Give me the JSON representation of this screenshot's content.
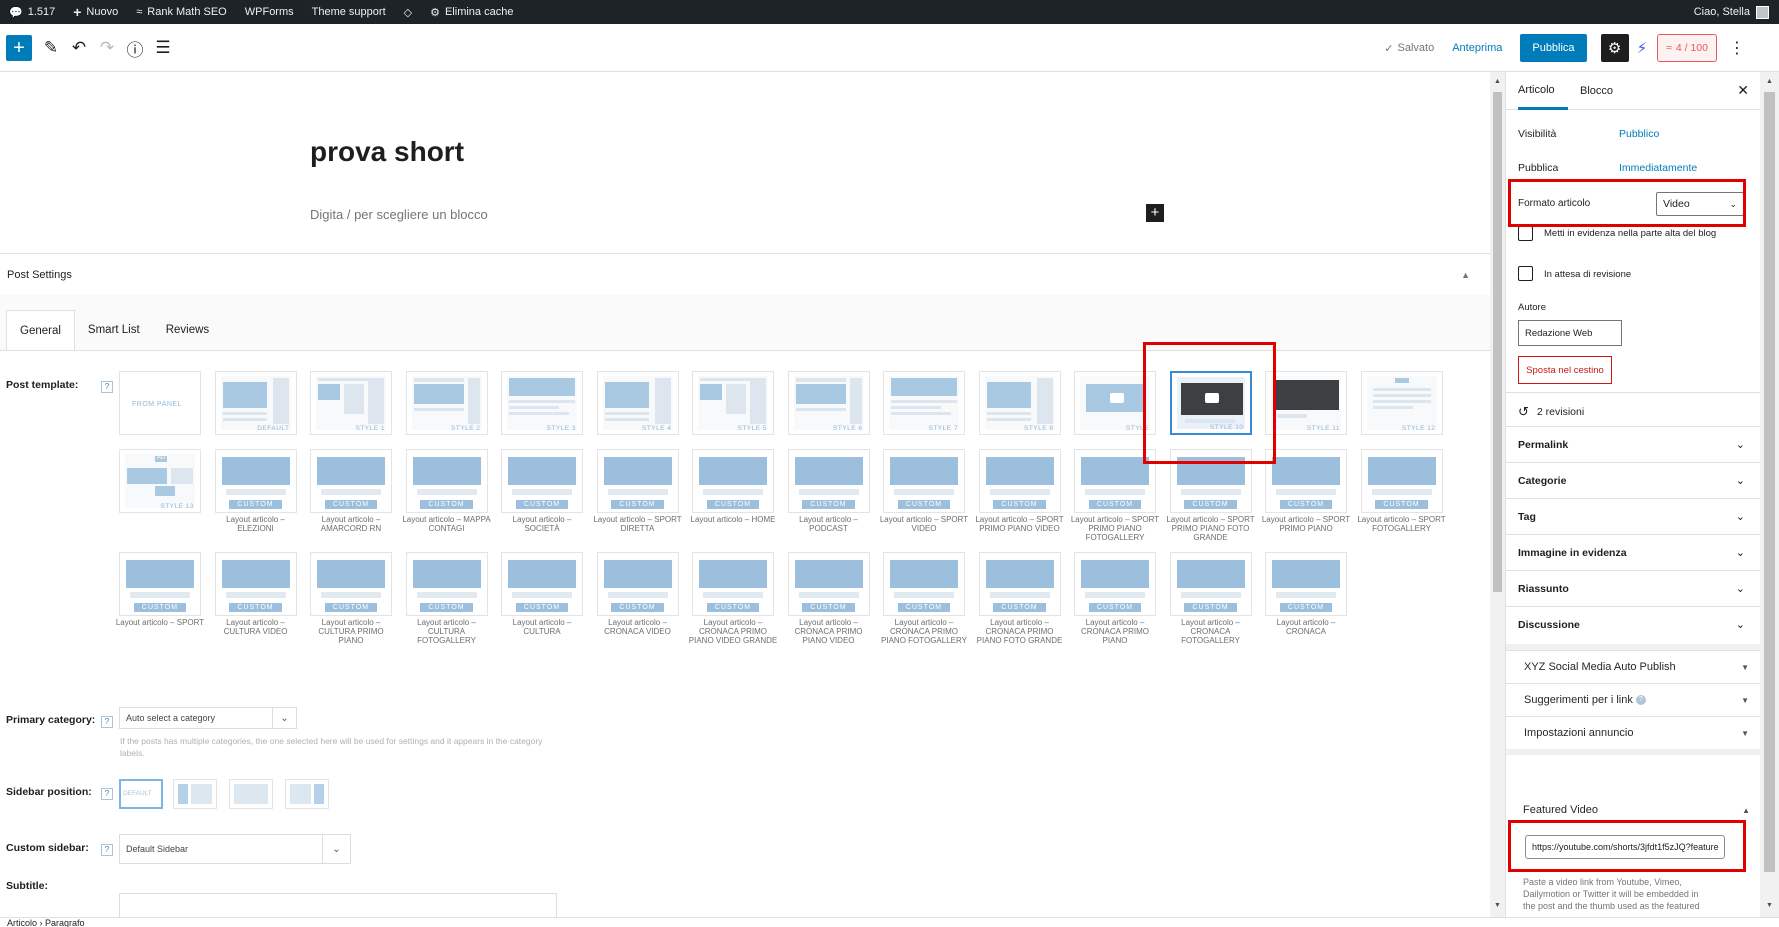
{
  "admin_bar": {
    "comments_count": "1.517",
    "new_label": "Nuovo",
    "rankmath": "Rank Math SEO",
    "wpforms": "WPForms",
    "theme_support": "Theme support",
    "clear_cache": "Elimina cache",
    "greeting": "Ciao, Stella"
  },
  "toolbar": {
    "saved": "Salvato",
    "preview": "Anteprima",
    "publish": "Pubblica",
    "score": "4 / 100"
  },
  "editor": {
    "title": "prova short",
    "block_hint": "Digita / per scegliere un blocco"
  },
  "post_settings": {
    "header": "Post Settings",
    "tabs": [
      "General",
      "Smart List",
      "Reviews"
    ],
    "post_template_label": "Post template:",
    "help": "?",
    "template_row1": [
      {
        "tag": "FROM PANEL"
      },
      {
        "tag": "DEFAULT"
      },
      {
        "tag": "STYLE 1"
      },
      {
        "tag": "STYLE 2"
      },
      {
        "tag": "STYLE 3"
      },
      {
        "tag": "STYLE 4"
      },
      {
        "tag": "STYLE 5"
      },
      {
        "tag": "STYLE 6"
      },
      {
        "tag": "STYLE 7"
      },
      {
        "tag": "STYLE 8"
      },
      {
        "tag": "STYLE"
      },
      {
        "tag": "STYLE 10"
      },
      {
        "tag": "STYLE 11"
      },
      {
        "tag": "STYLE 12"
      }
    ],
    "style13_tag": "STYLE 13",
    "ad_tag": "AD",
    "custom_tag": "CUSTOM",
    "layouts_row2": [
      "Layout articolo – ELEZIONI",
      "Layout articolo – AMARCORD RN",
      "Layout articolo – MAPPA CONTAGI",
      "Layout articolo – SOCIETÀ",
      "Layout articolo – SPORT DIRETTA",
      "Layout articolo – HOME",
      "Layout articolo – PODCAST",
      "Layout articolo – SPORT VIDEO",
      "Layout articolo – SPORT PRIMO PIANO VIDEO",
      "Layout articolo – SPORT PRIMO PIANO FOTOGALLERY",
      "Layout articolo – SPORT PRIMO PIANO FOTO GRANDE",
      "Layout articolo – SPORT PRIMO PIANO",
      "Layout articolo – SPORT FOTOGALLERY"
    ],
    "layouts_row3": [
      "Layout articolo – SPORT",
      "Layout articolo – CULTURA VIDEO",
      "Layout articolo – CULTURA PRIMO PIANO",
      "Layout articolo – CULTURA FOTOGALLERY",
      "Layout articolo – CULTURA",
      "Layout articolo – CRONACA VIDEO",
      "Layout articolo – CRONACA PRIMO PIANO VIDEO GRANDE",
      "Layout articolo – CRONACA PRIMO PIANO VIDEO",
      "Layout articolo – CRONACA PRIMO PIANO FOTOGALLERY",
      "Layout articolo – CRONACA PRIMO PIANO FOTO GRANDE",
      "Layout articolo – CRONACA PRIMO PIANO",
      "Layout articolo – CRONACA FOTOGALLERY",
      "Layout articolo – CRONACA"
    ],
    "primary_category_label": "Primary category:",
    "primary_category_value": "Auto select a category",
    "primary_category_help": "If the posts has multiple categories, the one selected here will be used for settings and it appears in the category labels.",
    "sidebar_position_label": "Sidebar position:",
    "sidebar_default_tag": "DEFAULT",
    "custom_sidebar_label": "Custom sidebar:",
    "custom_sidebar_value": "Default Sidebar",
    "subtitle_label": "Subtitle:"
  },
  "sidebar": {
    "tab_post": "Articolo",
    "tab_block": "Blocco",
    "visibility_label": "Visibilità",
    "visibility_value": "Pubblico",
    "publish_label": "Pubblica",
    "publish_value": "Immediatamente",
    "format_label": "Formato articolo",
    "format_value": "Video",
    "sticky_label": "Metti in evidenza nella parte alta del blog",
    "pending_label": "In attesa di revisione",
    "author_label": "Autore",
    "author_value": "Redazione Web",
    "trash": "Sposta nel cestino",
    "revisions": "2 revisioni",
    "panels": [
      "Permalink",
      "Categorie",
      "Tag",
      "Immagine in evidenza",
      "Riassunto",
      "Discussione"
    ],
    "plugin_panels": [
      "XYZ Social Media Auto Publish",
      "Suggerimenti per i link",
      "Impostazioni annuncio"
    ],
    "featured_video_title": "Featured Video",
    "featured_video_url": "https://youtube.com/shorts/3jfdt1f5zJQ?feature",
    "featured_video_help": "Paste a video link from Youtube, Vimeo, Dailymotion or Twitter it will be embedded in the post and the thumb used as the featured"
  },
  "footer": {
    "crumb1": "Articolo",
    "crumb2": "Paragrafo"
  },
  "colors": {
    "accent": "#007cba",
    "highlight": "#e00000",
    "admin_bar": "#1d2327"
  }
}
